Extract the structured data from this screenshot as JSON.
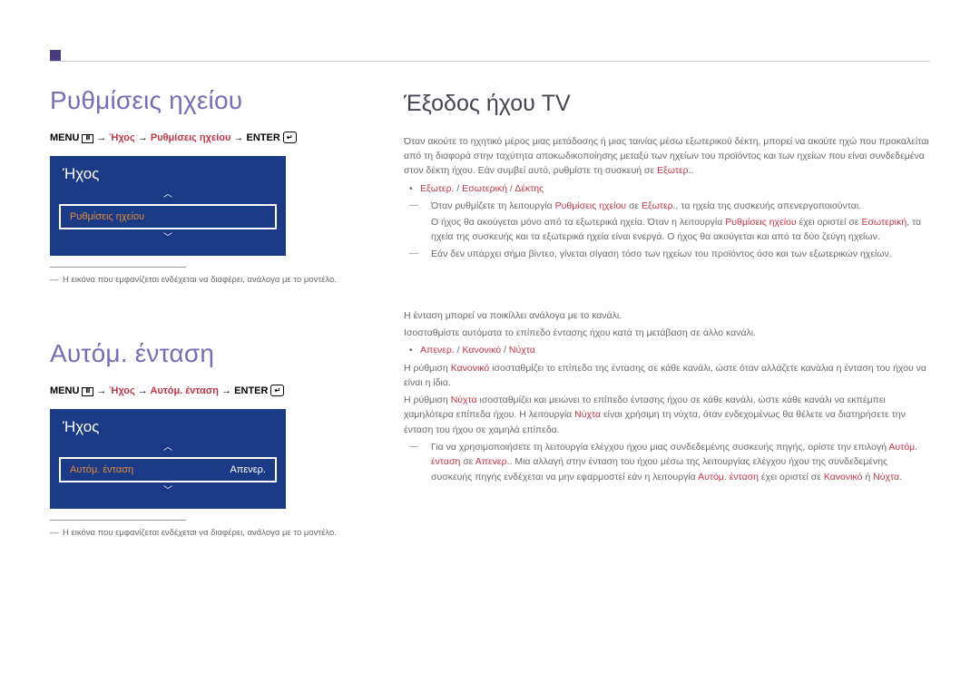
{
  "section1": {
    "title": "Ρυθμίσεις ηχείου",
    "breadcrumb_prefix": "MENU ",
    "breadcrumb_arrow": " → ",
    "breadcrumb_sound": "Ήχος",
    "breadcrumb_speaker": "Ρυθμίσεις ηχείου",
    "breadcrumb_enter": " ENTER ",
    "menu_title": "Ήχος",
    "menu_item_label": "Ρυθμίσεις ηχείου",
    "footnote": "Η εικόνα που εμφανίζεται ενδέχεται να διαφέρει, ανάλογα με το μοντέλο."
  },
  "section2": {
    "title": "Αυτόμ. ένταση",
    "breadcrumb_auto": "Αυτόμ. ένταση",
    "menu_title": "Ήχος",
    "menu_item_label": "Αυτόμ. ένταση",
    "menu_item_value": "Απενερ.",
    "footnote": "Η εικόνα που εμφανίζεται ενδέχεται να διαφέρει, ανάλογα με το μοντέλο."
  },
  "right1": {
    "title": "Έξοδος ήχου TV",
    "p1a": "Όταν ακούτε το ηχητικό μέρος μιας μετάδοσης ή μιας ταινίας μέσω εξωτερικού δέκτη, μπορεί να ακούτε ηχώ που προκαλείται από τη διαφορά στην ταχύτητα αποκωδικοποίησης μεταξύ των ηχείων του προϊόντος και των ηχείων που είναι συνδεδεμένα στον δέκτη ήχου. Εάν συμβεί αυτό, ρυθμίστε τη συσκευή σε ",
    "p1_ext": "Εξωτερ.",
    "p1_end": ".",
    "bullet1_a": "Εξωτερ.",
    "bullet1_s1": " / ",
    "bullet1_b": "Εσωτερική",
    "bullet1_s2": " / ",
    "bullet1_c": "Δέκτης",
    "d1a": "Όταν ρυθμίζετε τη λειτουργία ",
    "d1_r1": "Ρυθμίσεις ηχείου",
    "d1b": " σε ",
    "d1_r2": "Εξωτερ.",
    "d1c": ", τα ηχεία της συσκευής απενεργοποιούνται.",
    "d1_sub1": "Ο ήχος θα ακούγεται μόνο από τα εξωτερικά ηχεία. Όταν η λειτουργία ",
    "d1_sub_r1": "Ρυθμίσεις ηχείου",
    "d1_sub2": " έχει οριστεί σε ",
    "d1_sub_r2": "Εσωτερική",
    "d1_sub3": ", τα ηχεία της συσκευής και τα εξωτερικά ηχεία είναι ενεργά. Ο ήχος θα ακούγεται και από τα δύο ζεύγη ηχείων.",
    "d2": "Εάν δεν υπάρχει σήμα βίντεο, γίνεται σίγαση τόσο των ηχείων του προϊόντος όσο και των εξωτερικών ηχείων."
  },
  "right2": {
    "p1": "Η ένταση μπορεί να ποικίλλει ανάλογα με το κανάλι.",
    "p2": "Ισοσταθμίστε αυτόματα το επίπεδο έντασης ήχου κατά τη μετάβαση σε άλλο κανάλι.",
    "bullet_a": "Απενερ.",
    "bullet_s1": " / ",
    "bullet_b": "Κανονικό",
    "bullet_s2": " / ",
    "bullet_c": "Νύχτα",
    "p3a": "Η ρύθμιση ",
    "p3_r1": "Κανονικό",
    "p3b": " ισοσταθμίζει το επίπεδο της έντασης σε κάθε κανάλι, ώστε όταν αλλάζετε κανάλια η ένταση του ήχου να είναι η ίδια.",
    "p4a": "Η ρύθμιση ",
    "p4_r1": "Νύχτα",
    "p4b": " ισοσταθμίζει και μειώνει το επίπεδο έντασης ήχου σε κάθε κανάλι, ώστε κάθε κανάλι να εκπέμπει χαμηλότερα επίπεδα ήχου. Η λειτουργία ",
    "p4_r2": "Νύχτα",
    "p4c": " είναι χρήσιμη τη νύχτα, όταν ενδεχομένως θα θέλετε να διατηρήσετε την ένταση του ήχου σε χαμηλά επίπεδα.",
    "d1a": "Για να χρησιμοποιήσετε τη λειτουργία ελέγχου ήχου μιας συνδεδεμένης συσκευής πηγής, ορίστε την επιλογή ",
    "d1_r1": "Αυτόμ. ένταση",
    "d1b": " σε ",
    "d1_r2": "Απενερ.",
    "d1c": ". Μια αλλαγή στην ένταση του ήχου μέσω της λειτουργίας ελέγχου ήχου της συνδεδεμένης συσκευής πηγής ενδέχεται να μην εφαρμοστεί εάν η λειτουργία ",
    "d1_r3": "Αυτόμ. ένταση",
    "d1d": " έχει οριστεί σε ",
    "d1_r4": "Κανονικό",
    "d1e": " ή ",
    "d1_r5": "Νύχτα",
    "d1f": "."
  }
}
